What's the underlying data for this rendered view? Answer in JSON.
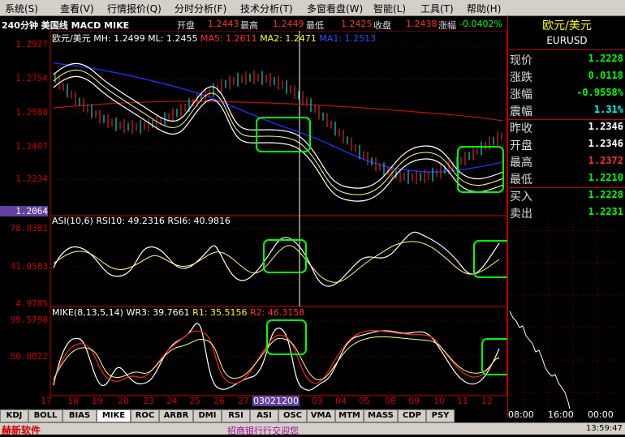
{
  "menu": [
    "系统(S)",
    "查看(V)",
    "行情报价(Q)",
    "分时分析(F)",
    "技术分析(T)",
    "多窗看盘(W)",
    "智能(L)",
    "工具(T)",
    "帮助(H)"
  ],
  "info": {
    "title": "240分钟 美国线 MACD MIKE",
    "open_label": "开盘",
    "open_value": "1.2443",
    "high_label": "最高",
    "high_value": "1.2449",
    "low_label": "最低",
    "low_value": "1.2425",
    "close_label": "收盘",
    "close_value": "1.2438",
    "change_label": "涨幅",
    "change_value": "-0.0402%"
  },
  "main_pane": {
    "header": "欧元/美元 MH: 1.2499 ML: 1.2455",
    "ma5": "MA5: 1.2611",
    "ma2": "MA2: 1.2471",
    "ma1": "MA1: 1.2513",
    "y_labels": [
      "1.2927",
      "1.2754",
      "1.2580",
      "1.2407",
      "1.2234",
      "1.2064"
    ]
  },
  "asi_pane": {
    "header": "ASI(10,6) RSI10: 49.2316 RSI6: 40.9816",
    "y_labels": [
      "78.9381",
      "41.9583",
      "4.9785"
    ]
  },
  "mike_pane": {
    "header": "MIKE(8,13,5,14) WR3: 39.7661",
    "r1": "R1: 35.5156",
    "r2": "R2: 46.3158",
    "y_labels": [
      "99.5798",
      "50.8022"
    ]
  },
  "x_labels": [
    "17",
    "18",
    "19",
    "20",
    "23",
    "24",
    "25",
    "26",
    "27",
    "03021200",
    "03",
    "04",
    "05",
    "08",
    "09",
    "10",
    "11",
    "12"
  ],
  "quote": {
    "name": "欧元/美元",
    "code": "EURUSD",
    "rows": [
      {
        "label": "现价",
        "value": "1.2228",
        "color": "#00ff00"
      },
      {
        "label": "涨跌",
        "value": "0.0118",
        "color": "#00ff00"
      },
      {
        "label": "涨幅",
        "value": "-0.9558%",
        "color": "#00ff00"
      },
      {
        "label": "震幅",
        "value": "1.31%",
        "color": "#00ffff"
      },
      {
        "label": "昨收",
        "value": "1.2346",
        "color": "#ffffff"
      },
      {
        "label": "开盘",
        "value": "1.2346",
        "color": "#ffffff"
      },
      {
        "label": "最高",
        "value": "1.2372",
        "color": "#ff3030"
      },
      {
        "label": "最低",
        "value": "1.2210",
        "color": "#00ff00"
      },
      {
        "label": "买入",
        "value": "1.2228",
        "color": "#00ff00"
      },
      {
        "label": "卖出",
        "value": "1.2231",
        "color": "#00ff00"
      }
    ],
    "time_labels": [
      "08:00",
      "16:00",
      "00:00"
    ]
  },
  "tabs": [
    "KDJ",
    "BOLL",
    "BIAS",
    "MIKE",
    "ROC",
    "ARBR",
    "DMI",
    "RSI",
    "ASI",
    "OSC",
    "VMA",
    "MTM",
    "MASS",
    "CDP",
    "PSY"
  ],
  "active_tab": "MIKE",
  "status": {
    "brand": "赫新软件",
    "ticker": "招商银行行交迎您",
    "time": "13:59:47"
  },
  "colors": {
    "up": "#ff3030",
    "down": "#00ffff",
    "grid": "#800000",
    "highlight": "#00ff00"
  }
}
